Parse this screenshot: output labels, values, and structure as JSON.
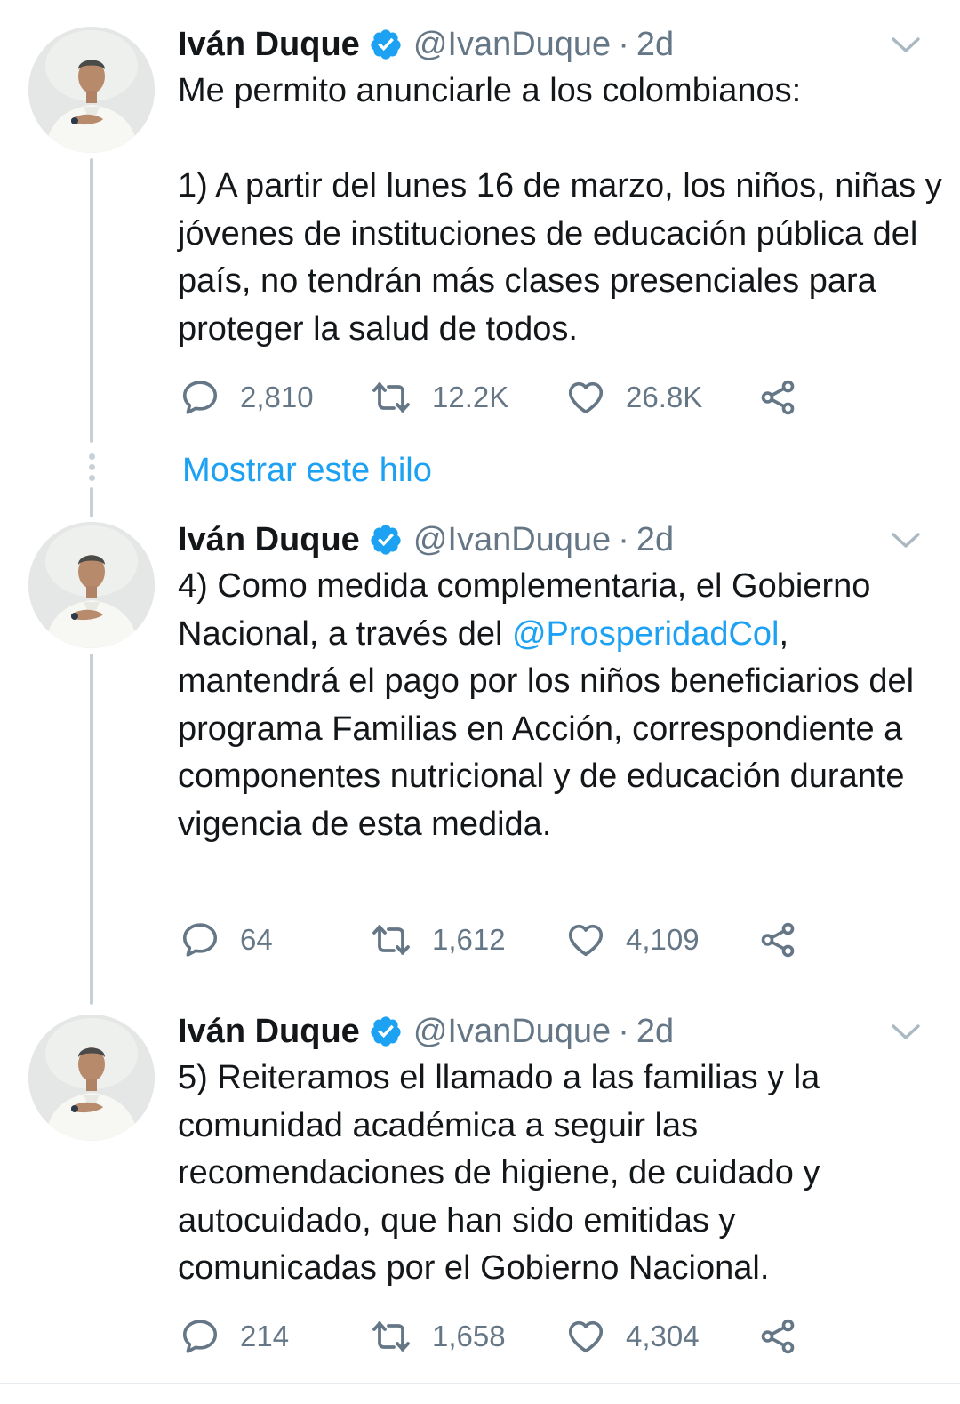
{
  "colors": {
    "text": "#14171a",
    "muted": "#657786",
    "accent": "#1da1f2",
    "thread_line": "#c7d0d7"
  },
  "show_thread_label": "Mostrar este hilo",
  "tweets": [
    {
      "author": "Iván Duque",
      "handle": "@IvanDuque",
      "separator": "·",
      "time": "2d",
      "text": {
        "line1": "Me permito anunciarle a los colombianos:",
        "line2": "1) A partir del lunes 16 de marzo, los niños, niñas y jóvenes de instituciones de educación pública del país, no tendrán más clases presenciales para proteger la salud de todos."
      },
      "replies": "2,810",
      "retweets": "12.2K",
      "likes": "26.8K"
    },
    {
      "author": "Iván Duque",
      "handle": "@IvanDuque",
      "separator": "·",
      "time": "2d",
      "text": {
        "before_mention": "4) Como medida complementaria, el Gobierno Nacional, a través del ",
        "mention": "@ProsperidadCol",
        "after_mention": ", mantendrá el pago por los niños beneficiarios del programa Familias en Acción, correspondiente a componentes nutricional y de educación durante vigencia de esta medida."
      },
      "replies": "64",
      "retweets": "1,612",
      "likes": "4,109"
    },
    {
      "author": "Iván Duque",
      "handle": "@IvanDuque",
      "separator": "·",
      "time": "2d",
      "text": {
        "line1": "5) Reiteramos el llamado a las familias y la comunidad académica a seguir las recomendaciones de higiene, de cuidado y autocuidado, que han sido emitidas y comunicadas por el Gobierno Nacional."
      },
      "replies": "214",
      "retweets": "1,658",
      "likes": "4,304"
    }
  ]
}
